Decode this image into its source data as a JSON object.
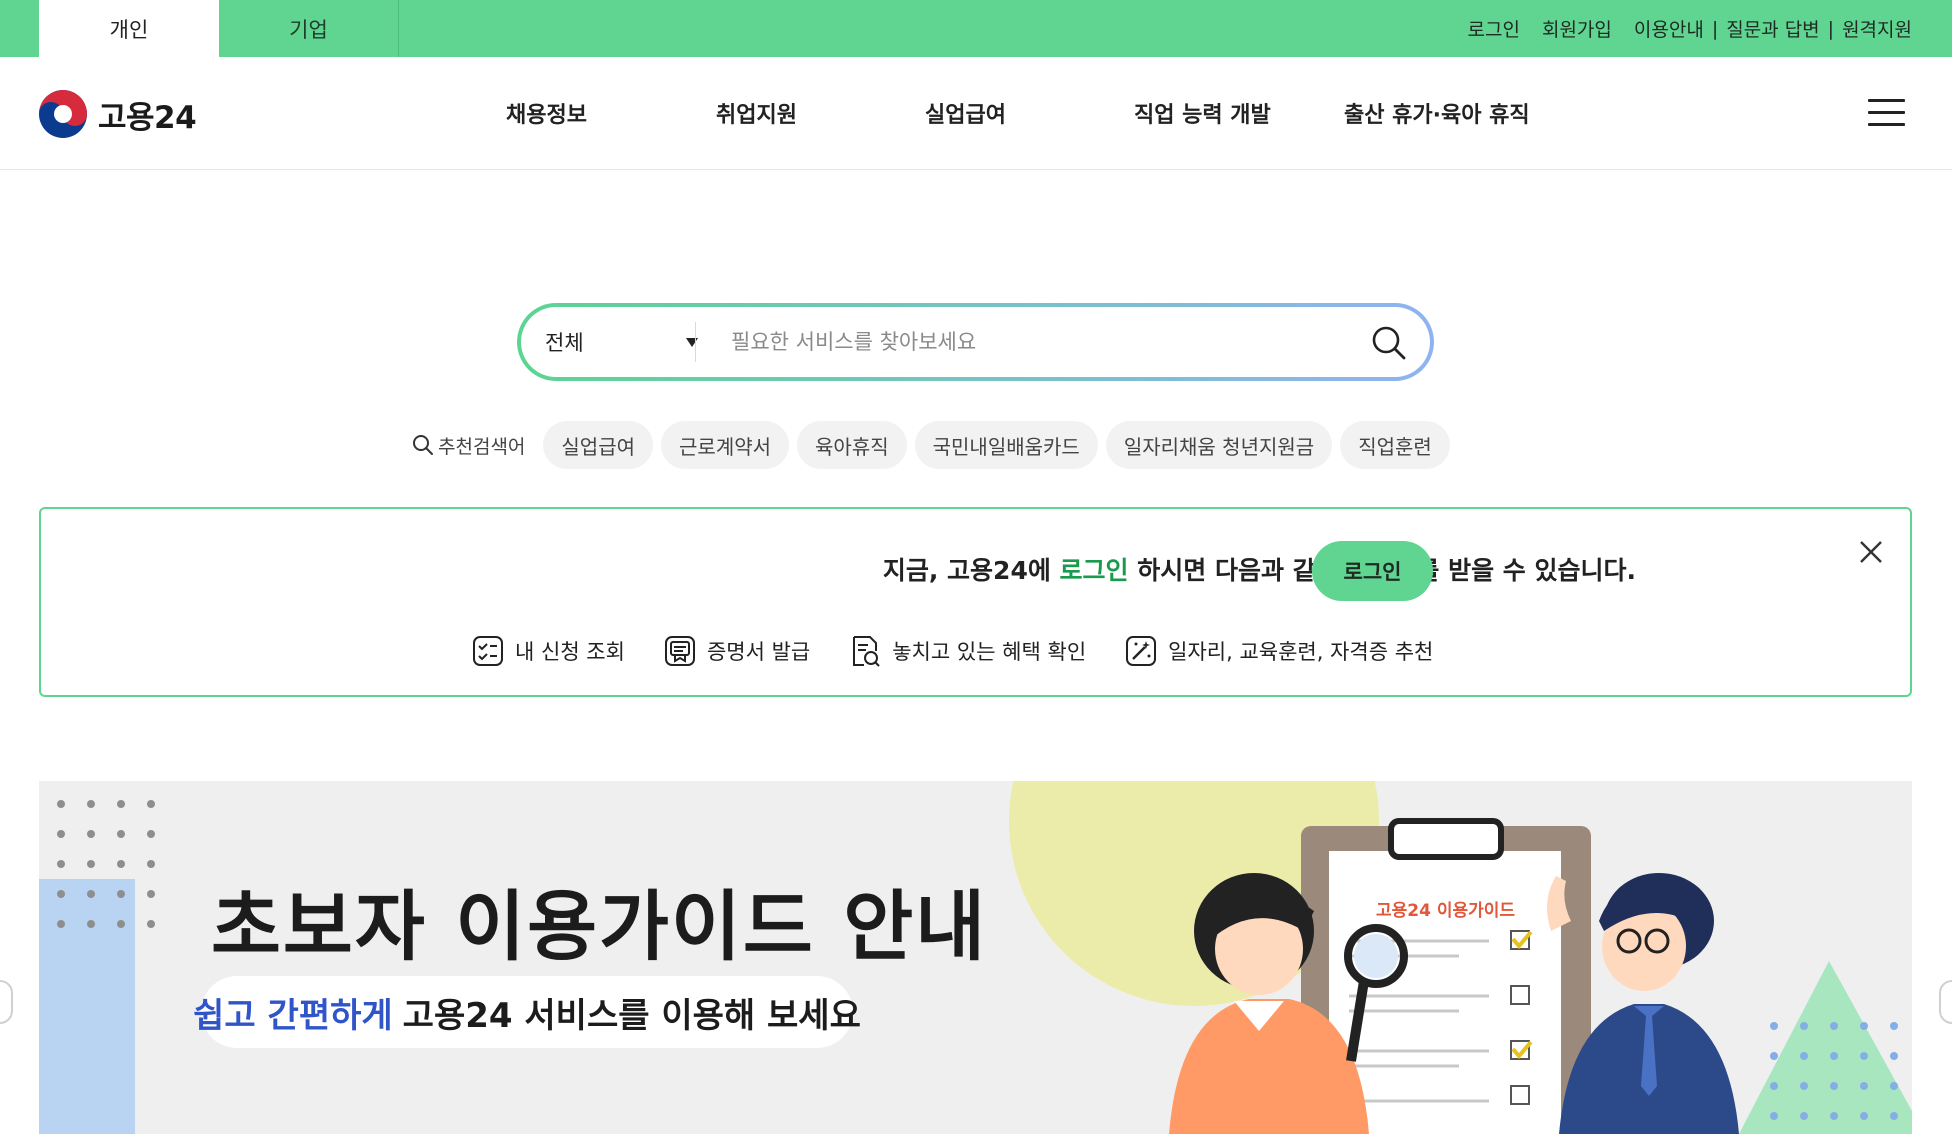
{
  "topbar": {
    "tabs": [
      {
        "label": "개인"
      },
      {
        "label": "기업"
      }
    ],
    "links": {
      "login": "로그인",
      "signup": "회원가입",
      "guide": "이용안내",
      "qna": "질문과 답변",
      "remote": "원격지원"
    },
    "separator": "|"
  },
  "header": {
    "logo_text": "고용24",
    "nav": [
      "채용정보",
      "취업지원",
      "실업급여",
      "직업 능력 개발",
      "출산 휴가·육아 휴직"
    ]
  },
  "search": {
    "category": "전체",
    "placeholder": "필요한 서비스를 찾아보세요"
  },
  "recommended": {
    "label": "추천검색어",
    "keywords": [
      "실업급여",
      "근로계약서",
      "육아휴직",
      "국민내일배움카드",
      "일자리채움 청년지원금",
      "직업훈련"
    ]
  },
  "login_banner": {
    "msg_before": "지금, 고용24에 ",
    "msg_highlight": "로그인",
    "msg_after": " 하시면 다음과 같은 서비스를 받을 수 있습니다.",
    "button": "로그인",
    "services": [
      "내 신청 조회",
      "증명서 발급",
      "놓치고 있는 혜택 확인",
      "일자리, 교육훈련, 자격증 추천"
    ]
  },
  "hero": {
    "title": "초보자 이용가이드 안내",
    "subtitle_highlight": "쉽고 간편하게",
    "subtitle_rest": "고용24 서비스를 이용해 보세요",
    "clipboard_label": "고용24 이용가이드"
  },
  "colors": {
    "brand_green": "#5fd591",
    "highlight_green": "#1a9a4c",
    "hero_blue": "#2f55c8"
  }
}
